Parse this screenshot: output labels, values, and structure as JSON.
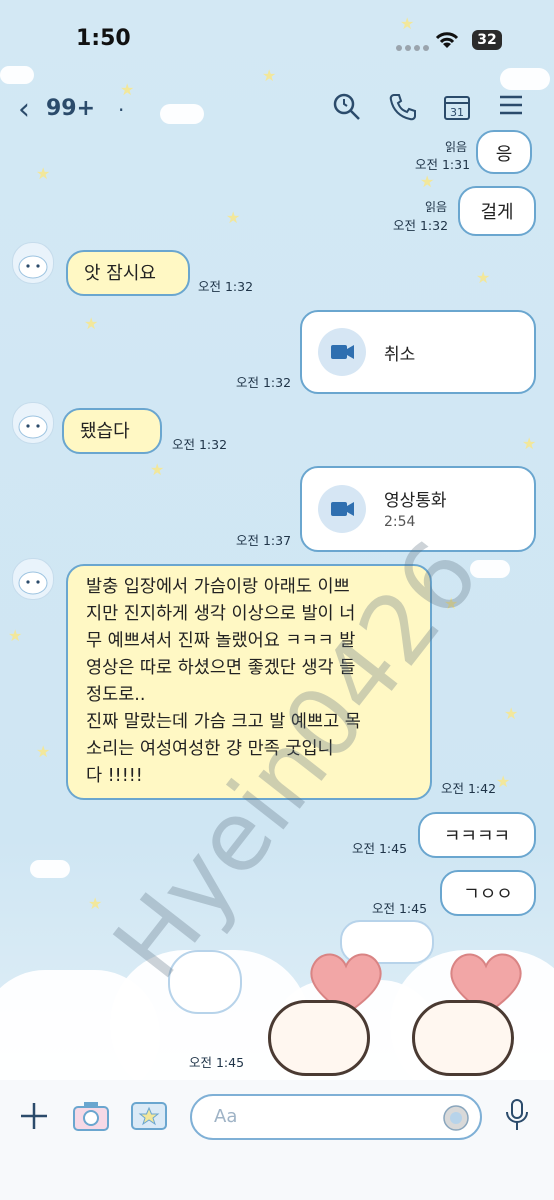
{
  "status_bar": {
    "time": "1:50",
    "battery": "32"
  },
  "nav": {
    "back_count": "99+"
  },
  "messages": [
    {
      "text": "응",
      "read": "읽음",
      "time": "오전 1:31"
    },
    {
      "text": "걸게",
      "read": "읽음",
      "time": "오전 1:32"
    },
    {
      "text": "앗 잠시요",
      "time": "오전 1:32"
    },
    {
      "title": "취소",
      "time": "오전 1:32"
    },
    {
      "text": "됐습다",
      "time": "오전 1:32"
    },
    {
      "title": "영상통화",
      "duration": "2:54",
      "time": "오전 1:37"
    },
    {
      "lines": [
        "발충 입장에서 가슴이랑 아래도 이쁘",
        "지만 진지하게 생각 이상으로 발이 너",
        "무 예쁘셔서 진짜 놀랬어요 ㅋㅋㅋ 발",
        "영상은 따로 하셨으면 좋겠단 생각 들",
        "정도로..",
        "진짜 말랐는데 가슴 크고 발 예쁘고 목",
        "소리는 여성여성한 걍 만족 굿입니",
        "다 !!!!!"
      ],
      "time": "오전 1:42"
    },
    {
      "text": "ㅋㅋㅋㅋ",
      "time": "오전 1:45"
    },
    {
      "text": "ㄱㅇㅇ",
      "time": "오전 1:45"
    },
    {
      "time": "오전 1:45"
    }
  ],
  "input": {
    "placeholder": "Aa"
  },
  "watermark": "Hyein0426"
}
